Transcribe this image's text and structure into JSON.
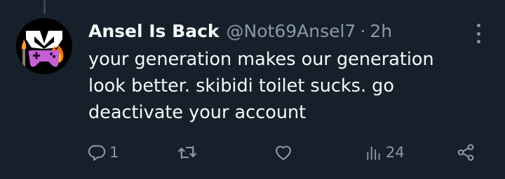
{
  "tweet": {
    "author": {
      "display_name": "Ansel Is Back",
      "handle": "@Not69Ansel7",
      "avatar_icon": "gamepad-fire-avatar"
    },
    "separator": "·",
    "time": "2h",
    "text_lines": [
      "your generation makes our generation",
      "look better. skibidi toilet sucks. go",
      "deactivate your account"
    ],
    "actions": {
      "reply": {
        "icon": "reply-icon",
        "count": "1"
      },
      "retweet": {
        "icon": "retweet-icon"
      },
      "like": {
        "icon": "heart-icon"
      },
      "views": {
        "icon": "views-icon",
        "count": "24"
      },
      "share": {
        "icon": "share-icon"
      }
    },
    "more_icon": "more-options-icon"
  },
  "colors": {
    "background": "#15202b",
    "text_primary": "#f7f9f9",
    "text_secondary": "#8b98a5",
    "thread_line": "#38444d"
  }
}
